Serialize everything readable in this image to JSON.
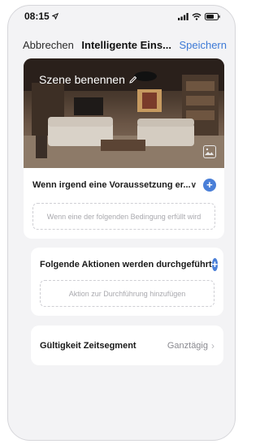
{
  "status": {
    "time": "08:15"
  },
  "nav": {
    "cancel_label": "Abbrechen",
    "title": "Intelligente Eins...",
    "save_label": "Speichern",
    "accent": "#3d7ad6"
  },
  "hero": {
    "scene_name": "Szene benennen"
  },
  "conditions": {
    "title": "Wenn irgend eine Voraussetzung er...",
    "placeholder": "Wenn eine der folgenden Bedingung erfüllt wird"
  },
  "actions": {
    "title": "Folgende Aktionen werden durchgeführt",
    "placeholder": "Aktion zur Durchführung hinzufügen"
  },
  "validity": {
    "label": "Gültigkeit Zeitsegment",
    "value": "Ganztägig"
  },
  "icons": {
    "location": "location-arrow-icon",
    "signal": "cellular-signal-icon",
    "wifi": "wifi-icon",
    "battery": "battery-icon",
    "edit": "pencil-icon",
    "image": "image-icon",
    "add": "plus-icon"
  }
}
